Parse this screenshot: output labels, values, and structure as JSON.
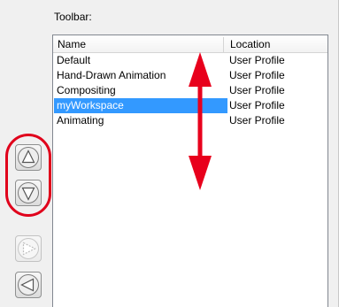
{
  "section_label": "Toolbar:",
  "list": {
    "columns": [
      "Name",
      "Location"
    ],
    "rows": [
      {
        "name": "Default",
        "location": "User Profile",
        "selected": false
      },
      {
        "name": "Hand-Drawn Animation",
        "location": "User Profile",
        "selected": false
      },
      {
        "name": "Compositing",
        "location": "User Profile",
        "selected": false
      },
      {
        "name": "myWorkspace",
        "location": "User Profile",
        "selected": true
      },
      {
        "name": "Animating",
        "location": "User Profile",
        "selected": false
      }
    ]
  },
  "side_buttons": [
    {
      "icon": "triangle-up-icon",
      "enabled": true
    },
    {
      "icon": "triangle-down-icon",
      "enabled": true
    },
    {
      "icon": "triangle-right-icon",
      "enabled": false
    },
    {
      "icon": "triangle-left-icon",
      "enabled": true
    }
  ],
  "annotations": {
    "arrow_color": "#e8001c",
    "highlight_color": "#e0001b"
  },
  "colors": {
    "selection": "#3399ff",
    "background": "#f0f0f0"
  }
}
